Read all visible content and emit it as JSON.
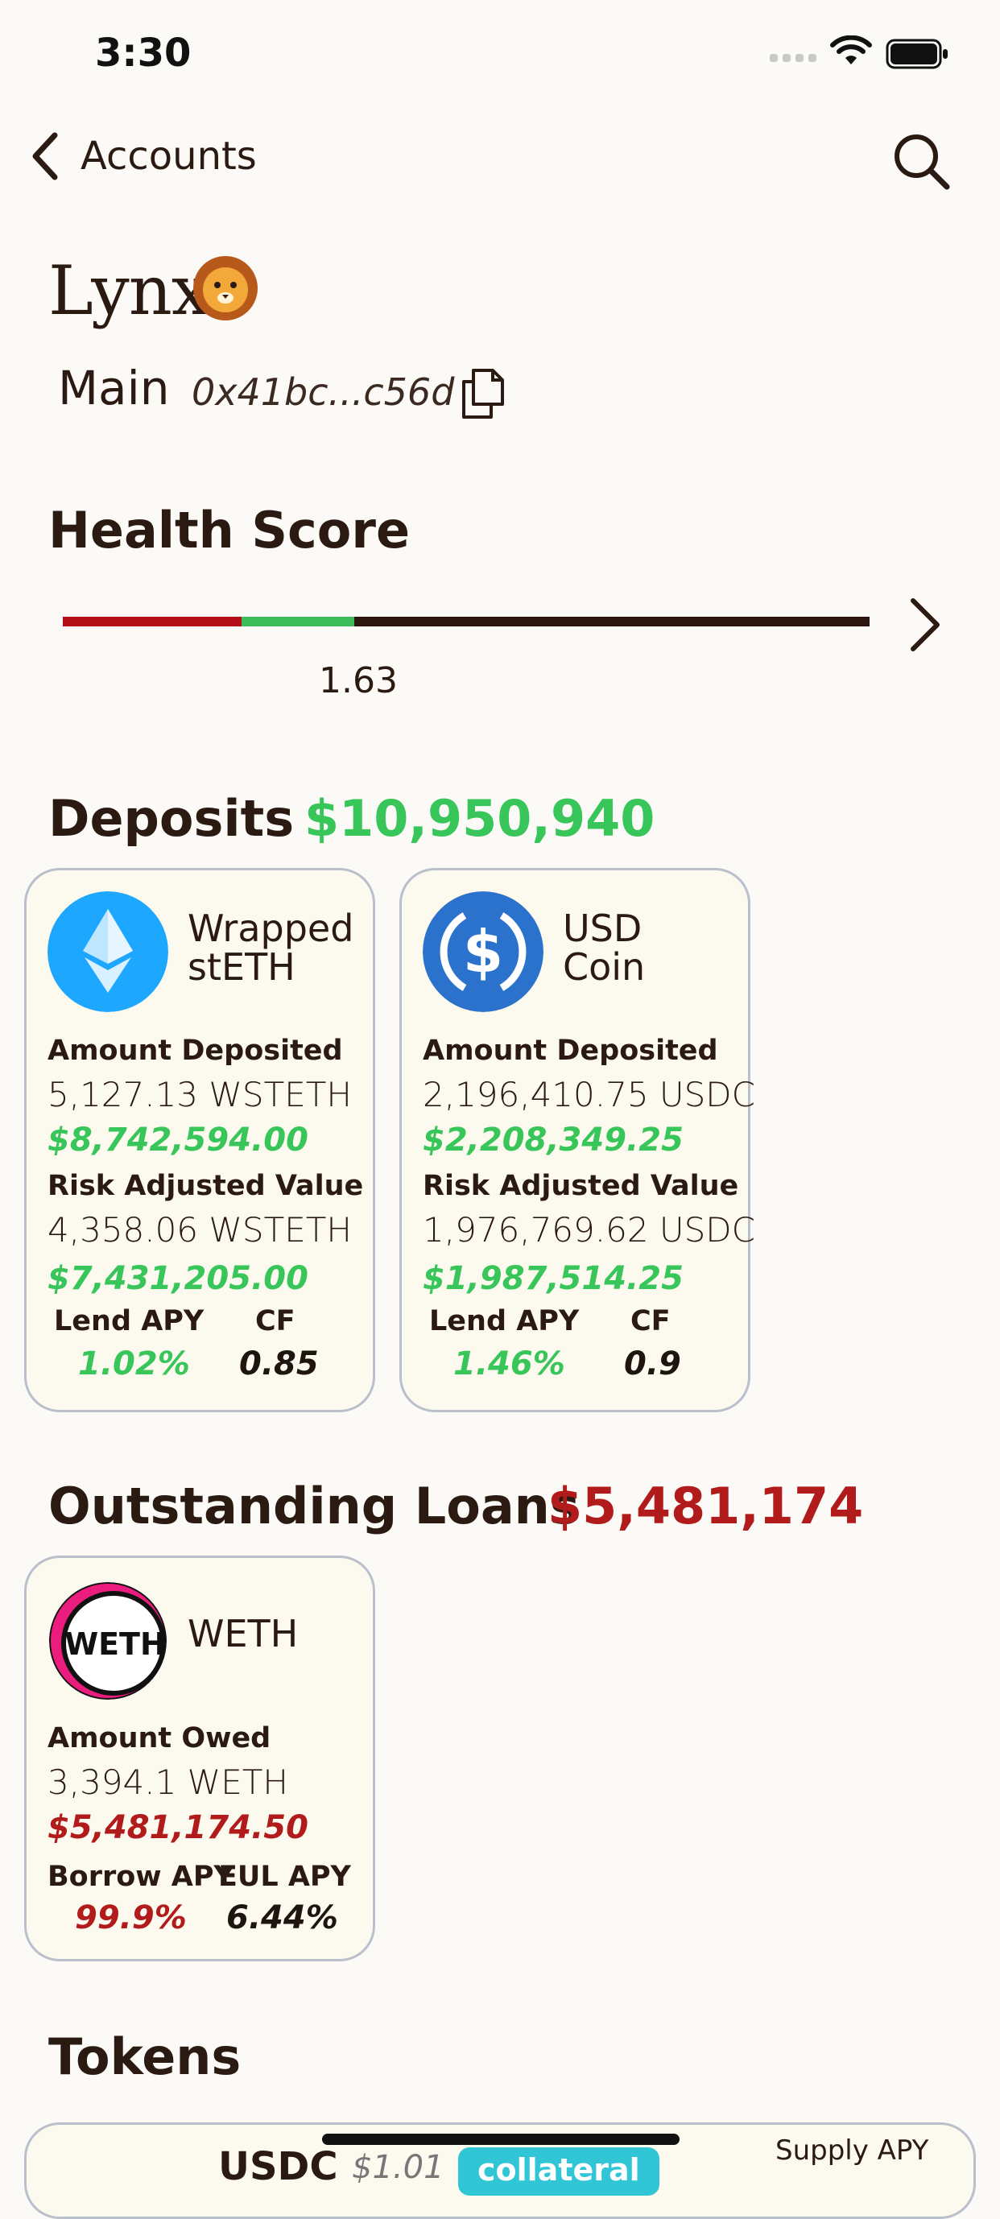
{
  "status_bar": {
    "time": "3:30"
  },
  "nav": {
    "back_label": "Accounts"
  },
  "account": {
    "name": "Lynx",
    "wallet_label": "Main",
    "address": "0x41bc...c56d"
  },
  "health": {
    "title": "Health Score",
    "value": "1.63",
    "score": 1.63
  },
  "deposits": {
    "title": "Deposits",
    "total": "$10,950,940",
    "cards": [
      {
        "name": "Wrapped stETH",
        "name_line1": "Wrapped",
        "name_line2": "stETH",
        "amount_label": "Amount Deposited",
        "amount": "5,127.13 WSTETH",
        "amount_usd": "$8,742,594.00",
        "risk_label": "Risk Adjusted Value",
        "risk_amount": "4,358.06 WSTETH",
        "risk_usd": "$7,431,205.00",
        "apy_label": "Lend APY",
        "apy": "1.02%",
        "cf_label": "CF",
        "cf": "0.85",
        "icon": "wsteth-icon"
      },
      {
        "name": "USD Coin",
        "name_line1": "USD",
        "name_line2": "Coin",
        "amount_label": "Amount Deposited",
        "amount": "2,196,410.75 USDC",
        "amount_usd": "$2,208,349.25",
        "risk_label": "Risk Adjusted Value",
        "risk_amount": "1,976,769.62 USDC",
        "risk_usd": "$1,987,514.25",
        "apy_label": "Lend APY",
        "apy": "1.46%",
        "cf_label": "CF",
        "cf": "0.9",
        "icon": "usdc-icon"
      }
    ]
  },
  "loans": {
    "title": "Outstanding Loans",
    "total": "$5,481,174",
    "cards": [
      {
        "name": "WETH",
        "logo_text": "WETH",
        "amount_label": "Amount Owed",
        "amount": "3,394.1 WETH",
        "amount_usd": "$5,481,174.50",
        "borrow_label": "Borrow APY",
        "borrow_apy": "99.9%",
        "eul_label": "EUL APY",
        "eul_apy": "6.44%",
        "icon": "weth-icon"
      }
    ]
  },
  "tokens": {
    "title": "Tokens",
    "first_row": {
      "symbol": "USDC",
      "price": "$1.01",
      "badge": "collateral",
      "supply_label": "Supply APY"
    }
  },
  "colors": {
    "positive": "#38c559",
    "negative": "#b11b1b",
    "text": "#2a1a12",
    "background": "#fbfaf6"
  }
}
